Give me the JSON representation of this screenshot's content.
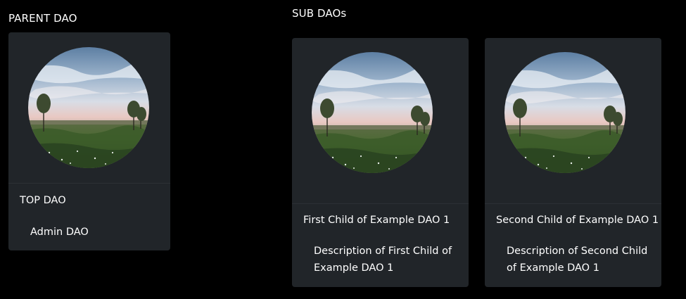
{
  "parent_section": {
    "title": "PARENT DAO",
    "card": {
      "name": "TOP DAO",
      "description": "Admin DAO",
      "image_icon": "landscape-photo"
    }
  },
  "sub_section": {
    "title": "SUB DAOs",
    "cards": [
      {
        "name": "First Child of Example DAO 1",
        "description": "Description of First Child of Example DAO 1",
        "image_icon": "landscape-photo"
      },
      {
        "name": "Second Child of Example DAO 1",
        "description": "Description of Second Child of Example DAO 1",
        "image_icon": "landscape-photo"
      }
    ]
  },
  "colors": {
    "page_background": "#000000",
    "card_background": "#212529",
    "text": "#ffffff"
  }
}
